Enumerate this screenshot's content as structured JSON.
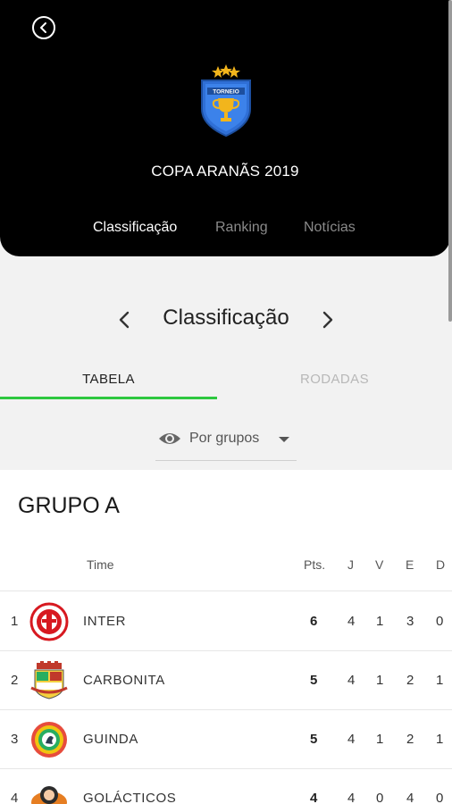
{
  "header": {
    "tournament_name": "COPA ARANÃS 2019",
    "logo_text": "TORNEIO",
    "tabs": [
      {
        "label": "Classificação",
        "active": true
      },
      {
        "label": "Ranking",
        "active": false
      },
      {
        "label": "Notícias",
        "active": false
      }
    ]
  },
  "section": {
    "title": "Classificação"
  },
  "view_tabs": [
    {
      "label": "TABELA",
      "active": true
    },
    {
      "label": "RODADAS",
      "active": false
    }
  ],
  "filter": {
    "value": "Por grupos"
  },
  "group": {
    "title": "GRUPO A",
    "columns": {
      "team": "Time",
      "pts": "Pts.",
      "j": "J",
      "v": "V",
      "e": "E",
      "d": "D"
    },
    "rows": [
      {
        "pos": "1",
        "team": "INTER",
        "pts": "6",
        "j": "4",
        "v": "1",
        "e": "3",
        "d": "0"
      },
      {
        "pos": "2",
        "team": "CARBONITA",
        "pts": "5",
        "j": "4",
        "v": "1",
        "e": "2",
        "d": "1"
      },
      {
        "pos": "3",
        "team": "GUINDA",
        "pts": "5",
        "j": "4",
        "v": "1",
        "e": "2",
        "d": "1"
      },
      {
        "pos": "4",
        "team": "GOLÁCTICOS",
        "pts": "4",
        "j": "4",
        "v": "0",
        "e": "4",
        "d": "0"
      }
    ]
  },
  "colors": {
    "header_bg": "#000000",
    "accent_green": "#2ec840",
    "page_bg": "#f2f2f2"
  }
}
